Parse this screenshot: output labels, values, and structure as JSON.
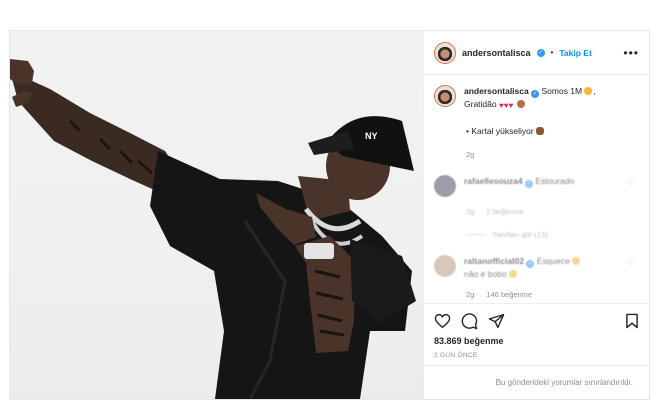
{
  "header": {
    "username": "andersontalisca",
    "separator": "•",
    "follow_label": "Takip Et",
    "more_label": "•••"
  },
  "caption": {
    "username": "andersontalisca",
    "text": "Somos 1M",
    "text_line2": "Gratidão",
    "hearts": "♥♥♥",
    "bullet_text": "• Kartal yükseliyor",
    "time": "2g"
  },
  "comments": [
    {
      "username": "rafaellesouza4",
      "text": "Estourado",
      "time": "2g",
      "likes": "2 beğenme",
      "avatar_color": "#4a4f5e"
    },
    {
      "username": "raltanofficial02",
      "text": "Esquece",
      "text_line2": "não é bobo",
      "time": "2g",
      "likes": "146 beğenme",
      "avatar_color": "#b99a86"
    }
  ],
  "replies_label": "Yanıtları gör (13)",
  "actions": {
    "likes_count": "83.869 beğenme",
    "posted_ago": "2 GÜN ÖNCE"
  },
  "restricted_notice": "Bu gönderideki yorumlar sınırlandırıldı.",
  "icons": {
    "like": "heart-outline-icon",
    "comment": "speech-bubble-icon",
    "share": "paper-plane-icon",
    "save": "bookmark-icon",
    "verified": "verified-badge-icon",
    "more": "more-dots-icon"
  },
  "colors": {
    "accent_blue": "#0095f6",
    "verified_blue": "#3897f0",
    "meta_gray": "#8e8e8e",
    "text_dark": "#262626"
  }
}
